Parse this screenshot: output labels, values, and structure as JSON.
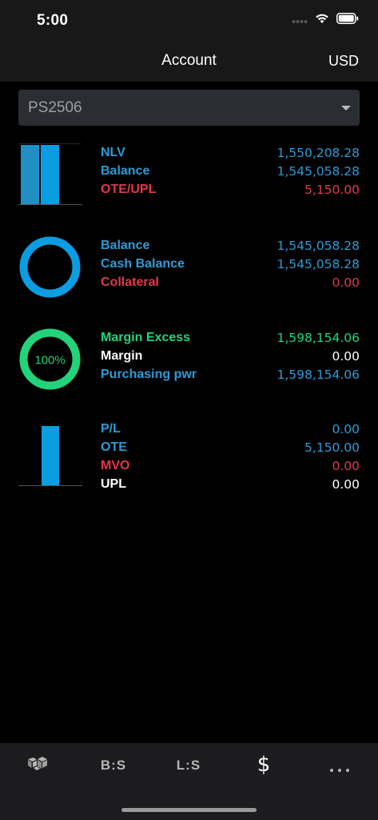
{
  "status": {
    "time": "5:00"
  },
  "nav": {
    "title": "Account",
    "currency": "USD"
  },
  "account": {
    "selected": "PS2506"
  },
  "sections": [
    {
      "rows": [
        {
          "label": "NLV",
          "value": "1,550,208.28",
          "label_color": "blue",
          "value_color": "blue"
        },
        {
          "label": "Balance",
          "value": "1,545,058.28",
          "label_color": "blue",
          "value_color": "blue"
        },
        {
          "label": "OTE/UPL",
          "value": "5,150.00",
          "label_color": "red",
          "value_color": "red"
        }
      ]
    },
    {
      "rows": [
        {
          "label": "Balance",
          "value": "1,545,058.28",
          "label_color": "blue",
          "value_color": "blue"
        },
        {
          "label": "Cash Balance",
          "value": "1,545,058.28",
          "label_color": "blue",
          "value_color": "blue"
        },
        {
          "label": "Collateral",
          "value": "0.00",
          "label_color": "red",
          "value_color": "red"
        }
      ]
    },
    {
      "ring_label": "100%",
      "rows": [
        {
          "label": "Margin Excess",
          "value": "1,598,154.06",
          "label_color": "green",
          "value_color": "green"
        },
        {
          "label": "Margin",
          "value": "0.00",
          "label_color": "white",
          "value_color": "white"
        },
        {
          "label": "Purchasing pwr",
          "value": "1,598,154.06",
          "label_color": "blue",
          "value_color": "blue"
        }
      ]
    },
    {
      "rows": [
        {
          "label": "P/L",
          "value": "0.00",
          "label_color": "blue",
          "value_color": "blue"
        },
        {
          "label": "OTE",
          "value": "5,150.00",
          "label_color": "blue",
          "value_color": "blue"
        },
        {
          "label": "MVO",
          "value": "0.00",
          "label_color": "red",
          "value_color": "red"
        },
        {
          "label": "UPL",
          "value": "0.00",
          "label_color": "white",
          "value_color": "white"
        }
      ]
    }
  ],
  "tabs": {
    "bs": "B:S",
    "ls": "L:S",
    "dollar": "$"
  },
  "colors": {
    "blue": "#2e9bd6",
    "red": "#e0394b",
    "green": "#22d37a",
    "bar": "#0a9de2"
  }
}
